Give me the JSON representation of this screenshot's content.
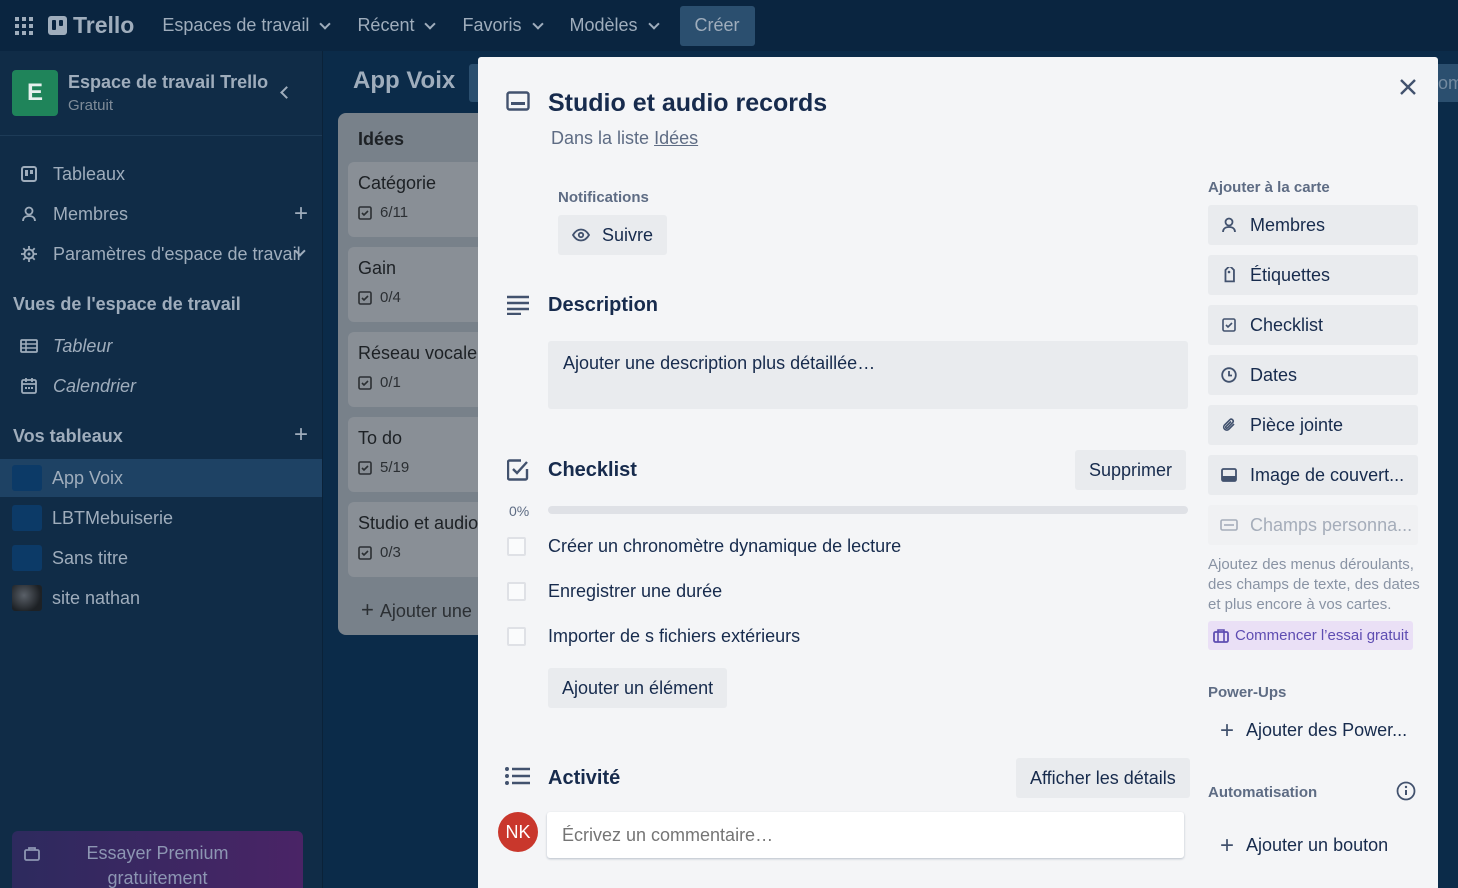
{
  "topbar": {
    "logo": "Trello",
    "nav": [
      {
        "label": "Espaces de travail"
      },
      {
        "label": "Récent"
      },
      {
        "label": "Favoris"
      },
      {
        "label": "Modèles"
      }
    ],
    "create": "Créer"
  },
  "sidebar": {
    "workspace_initial": "E",
    "workspace_name": "Espace de travail Trello",
    "workspace_plan": "Gratuit",
    "items": [
      {
        "label": "Tableaux",
        "icon": "board-icon"
      },
      {
        "label": "Membres",
        "icon": "person-icon"
      },
      {
        "label": "Paramètres d'espace de travail",
        "icon": "gear-icon"
      }
    ],
    "views_heading": "Vues de l'espace de travail",
    "views": [
      {
        "label": "Tableur",
        "icon": "table-icon"
      },
      {
        "label": "Calendrier",
        "icon": "calendar-icon"
      }
    ],
    "boards_heading": "Vos tableaux",
    "boards": [
      {
        "label": "App Voix",
        "color": "#0c3a67"
      },
      {
        "label": "LBTMebuiserie",
        "color": "#0c3a67"
      },
      {
        "label": "Sans titre",
        "color": "#0c3a67"
      },
      {
        "label": "site nathan",
        "color": "#1d2125"
      }
    ],
    "premium": "Essayer Premium gratuitement"
  },
  "board": {
    "title": "App Voix",
    "behind_text": "om",
    "list": {
      "title": "Idées",
      "cards": [
        {
          "title": "Catégorie",
          "badge": "6/11"
        },
        {
          "title": "Gain",
          "badge": "0/4"
        },
        {
          "title": "Réseau vocale",
          "badge": "0/1"
        },
        {
          "title": "To do",
          "badge": "5/19"
        },
        {
          "title": "Studio et audio",
          "badge": "0/3"
        }
      ],
      "add_label": "Ajouter une"
    }
  },
  "modal": {
    "title": "Studio et audio records",
    "in_list_prefix": "Dans la liste",
    "in_list_name": "Idées",
    "notifications_label": "Notifications",
    "follow_label": "Suivre",
    "description_title": "Description",
    "description_placeholder": "Ajouter une description plus détaillée…",
    "checklist_title": "Checklist",
    "checklist_delete": "Supprimer",
    "checklist_progress_label": "0%",
    "checklist_progress": 0,
    "checklist_items": [
      {
        "label": "Créer un chronomètre dynamique de lecture"
      },
      {
        "label": "Enregistrer une durée"
      },
      {
        "label": "Importer de s fichiers extérieurs"
      }
    ],
    "add_item": "Ajouter un élément",
    "activity_title": "Activité",
    "show_details": "Afficher les détails",
    "user_initials": "NK",
    "comment_placeholder": "Écrivez un commentaire…"
  },
  "card_sidebar": {
    "add_heading": "Ajouter à la carte",
    "buttons": [
      {
        "label": "Membres",
        "icon": "person-icon"
      },
      {
        "label": "Étiquettes",
        "icon": "tag-icon"
      },
      {
        "label": "Checklist",
        "icon": "checklist-icon"
      },
      {
        "label": "Dates",
        "icon": "clock-icon"
      },
      {
        "label": "Pièce jointe",
        "icon": "paperclip-icon"
      },
      {
        "label": "Image de couvert...",
        "icon": "cover-icon"
      },
      {
        "label": "Champs personna...",
        "icon": "custom-fields-icon"
      }
    ],
    "custom_fields_note": "Ajoutez des menus déroulants, des champs de texte, des dates et plus encore à vos cartes.",
    "trial": "Commencer l’essai gratuit",
    "powerups_heading": "Power-Ups",
    "add_powerups": "Ajouter des Power...",
    "automation_heading": "Automatisation",
    "add_button": "Ajouter un bouton"
  }
}
